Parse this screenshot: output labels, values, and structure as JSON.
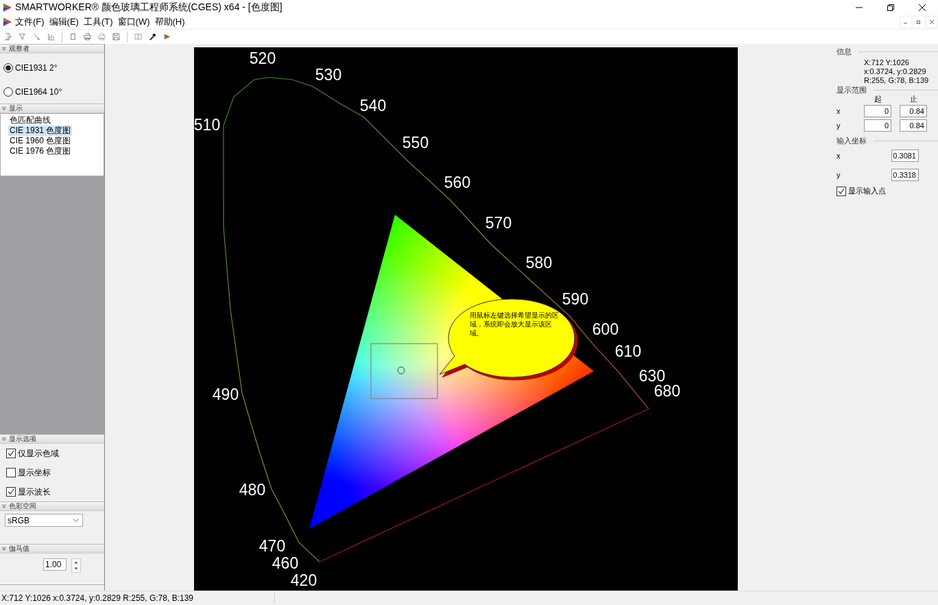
{
  "window": {
    "title": "SMARTWORKER® 颜色玻璃工程师系统(CGES) x64  - [色度图]"
  },
  "menu": [
    "文件(F)",
    "编辑(E)",
    "工具(T)",
    "窗口(W)",
    "帮助(H)"
  ],
  "observer": {
    "header": "观察者",
    "options": [
      {
        "label": "CIE1931 2°",
        "selected": true
      },
      {
        "label": "CIE1964 10°",
        "selected": false
      }
    ]
  },
  "display": {
    "header": "显示",
    "items": [
      {
        "label": "色匹配曲线",
        "selected": false
      },
      {
        "label": "CIE 1931 色度图",
        "selected": true
      },
      {
        "label": "CIE 1960 色度图",
        "selected": false
      },
      {
        "label": "CIE 1976 色度图",
        "selected": false
      }
    ]
  },
  "display_options": {
    "header": "显示选项",
    "items": [
      {
        "label": "仅显示色域",
        "checked": true
      },
      {
        "label": "显示坐标",
        "checked": false
      },
      {
        "label": "显示波长",
        "checked": true
      }
    ]
  },
  "color_space": {
    "header": "色彩空间",
    "value": "sRGB"
  },
  "gamma": {
    "header": "伽马值",
    "value": "1.00"
  },
  "diagram": {
    "wavelength_labels": [
      "420",
      "460",
      "470",
      "480",
      "490",
      "510",
      "520",
      "530",
      "540",
      "550",
      "560",
      "570",
      "580",
      "590",
      "600",
      "610",
      "630",
      "680"
    ],
    "callout": "用鼠标左键选择希望显示的区域，系统即会放大显示该区域。"
  },
  "info": {
    "header": "信息",
    "lines": [
      "X:712 Y:1026",
      "x:0.3724, y:0.2829",
      "R:255, G:78, B:139"
    ]
  },
  "range": {
    "header": "显示范围",
    "col_from": "起",
    "col_to": "止",
    "rows": [
      {
        "axis": "x",
        "from": "0",
        "to": "0.84"
      },
      {
        "axis": "y",
        "from": "0",
        "to": "0.84"
      }
    ]
  },
  "input": {
    "header": "输入坐标",
    "rows": [
      {
        "axis": "x",
        "value": "0.3081"
      },
      {
        "axis": "y",
        "value": "0.3318"
      }
    ],
    "show_point": {
      "label": "显示输入点",
      "checked": true
    }
  },
  "status_bar": "X:712 Y:1026 x:0.3724, y:0.2829 R:255, G:78, B:139"
}
